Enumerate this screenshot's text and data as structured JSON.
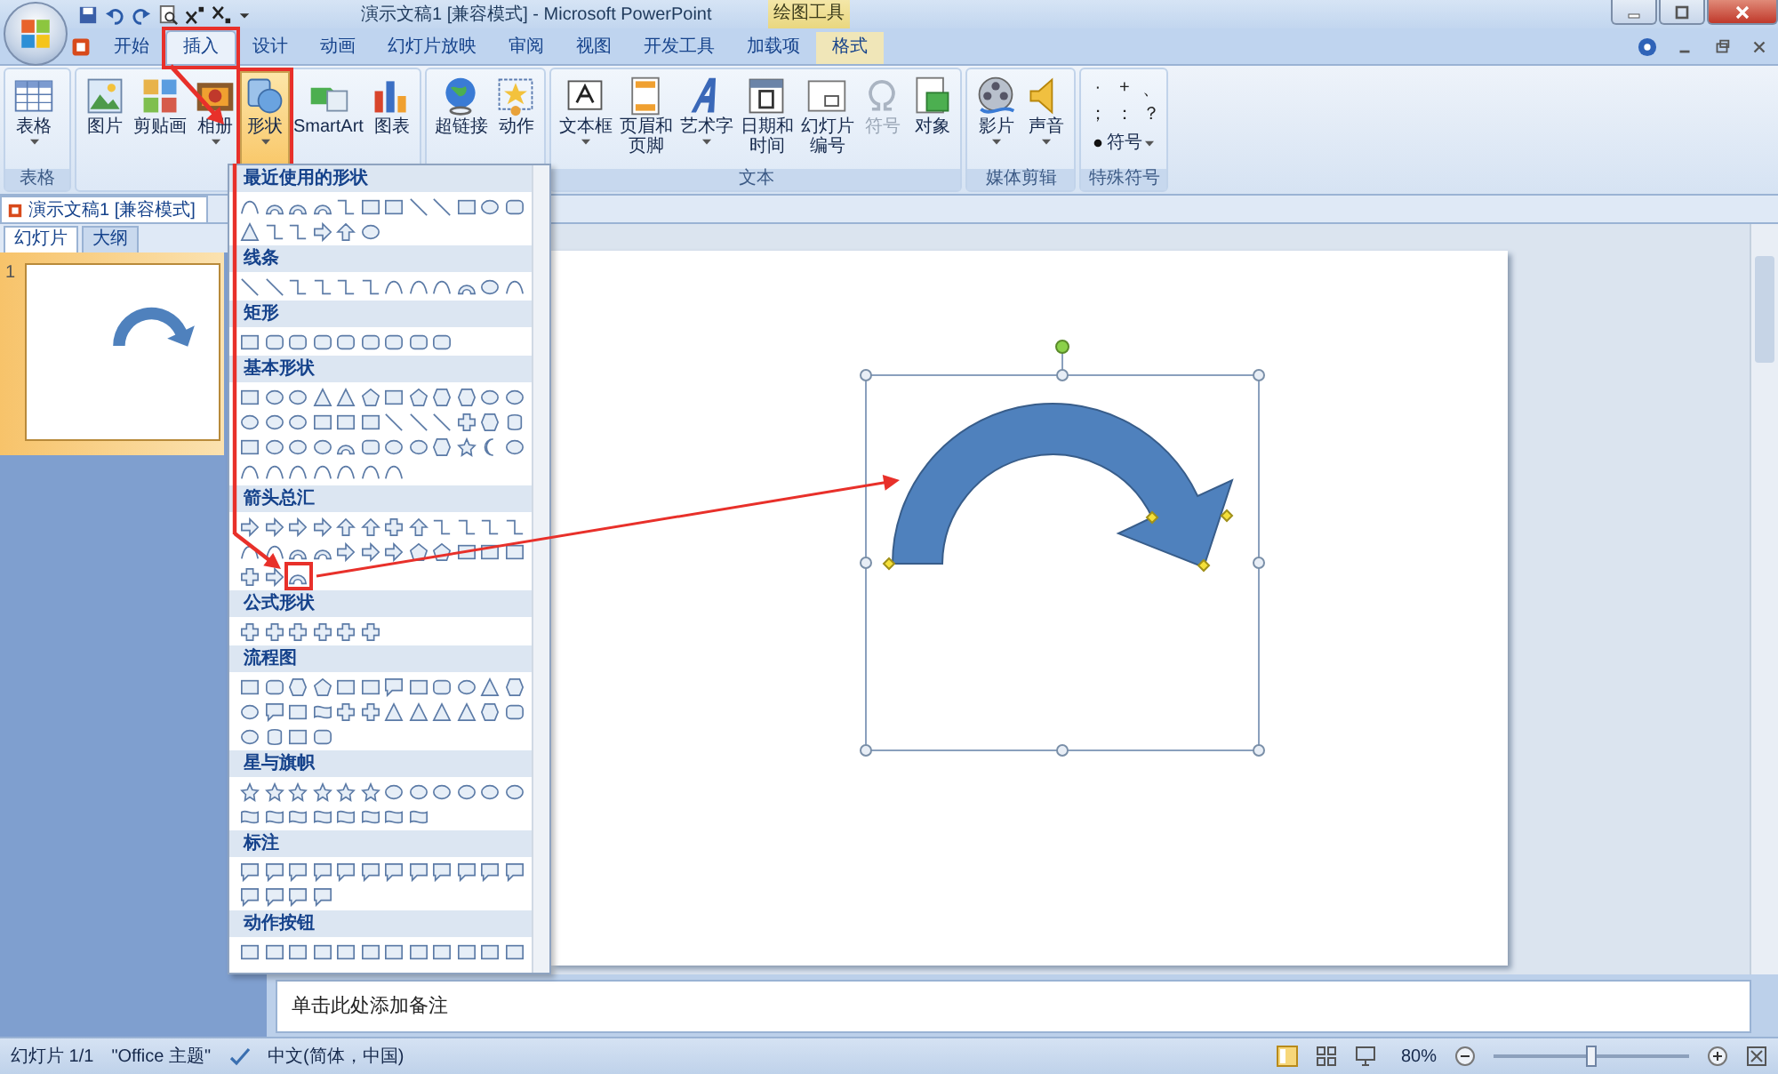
{
  "title_bar": {
    "title": "演示文稿1 [兼容模式] - Microsoft PowerPoint",
    "context_label": "绘图工具"
  },
  "tabs": [
    {
      "label": "开始",
      "selected": false,
      "annotated": false,
      "contextual": false
    },
    {
      "label": "插入",
      "selected": true,
      "annotated": true,
      "contextual": false
    },
    {
      "label": "设计",
      "selected": false,
      "annotated": false,
      "contextual": false
    },
    {
      "label": "动画",
      "selected": false,
      "annotated": false,
      "contextual": false
    },
    {
      "label": "幻灯片放映",
      "selected": false,
      "annotated": false,
      "contextual": false
    },
    {
      "label": "审阅",
      "selected": false,
      "annotated": false,
      "contextual": false
    },
    {
      "label": "视图",
      "selected": false,
      "annotated": false,
      "contextual": false
    },
    {
      "label": "开发工具",
      "selected": false,
      "annotated": false,
      "contextual": false
    },
    {
      "label": "加载项",
      "selected": false,
      "annotated": false,
      "contextual": false
    },
    {
      "label": "格式",
      "selected": false,
      "annotated": false,
      "contextual": true
    }
  ],
  "ribbon_groups": [
    {
      "kind": "buttons",
      "label": "表格",
      "buttons": [
        {
          "kind": "table",
          "lines": [
            "表格"
          ],
          "dropdown": true,
          "pressed": false,
          "disabled": false,
          "annotated": false
        }
      ]
    },
    {
      "kind": "buttons",
      "buttons": [
        {
          "kind": "picture",
          "lines": [
            "图片"
          ],
          "dropdown": false,
          "pressed": false,
          "disabled": false,
          "annotated": false
        },
        {
          "kind": "clipart",
          "lines": [
            "剪贴画"
          ],
          "dropdown": false,
          "pressed": false,
          "disabled": false,
          "annotated": false
        },
        {
          "kind": "album",
          "lines": [
            "相册"
          ],
          "dropdown": true,
          "pressed": false,
          "disabled": false,
          "annotated": false
        },
        {
          "kind": "shapes",
          "lines": [
            "形状"
          ],
          "dropdown": true,
          "pressed": true,
          "disabled": false,
          "annotated": true
        },
        {
          "kind": "smartart",
          "lines": [
            "SmartArt"
          ],
          "dropdown": false,
          "pressed": false,
          "disabled": false,
          "annotated": false
        },
        {
          "kind": "chart",
          "lines": [
            "图表"
          ],
          "dropdown": false,
          "pressed": false,
          "disabled": false,
          "annotated": false
        }
      ]
    },
    {
      "kind": "buttons",
      "buttons": [
        {
          "kind": "hyperlink",
          "lines": [
            "超链接"
          ],
          "dropdown": false,
          "pressed": false,
          "disabled": false,
          "annotated": false
        },
        {
          "kind": "action",
          "lines": [
            "动作"
          ],
          "dropdown": false,
          "pressed": false,
          "disabled": false,
          "annotated": false
        }
      ]
    },
    {
      "kind": "buttons",
      "label": "文本",
      "buttons": [
        {
          "kind": "textbox",
          "lines": [
            "文本框"
          ],
          "dropdown": true,
          "pressed": false,
          "disabled": false,
          "annotated": false
        },
        {
          "kind": "headerfooter",
          "lines": [
            "页眉和",
            "页脚"
          ],
          "dropdown": false,
          "pressed": false,
          "disabled": false,
          "annotated": false
        },
        {
          "kind": "wordart",
          "lines": [
            "艺术字"
          ],
          "dropdown": true,
          "pressed": false,
          "disabled": false,
          "annotated": false
        },
        {
          "kind": "datetime",
          "lines": [
            "日期和",
            "时间"
          ],
          "dropdown": false,
          "pressed": false,
          "disabled": false,
          "annotated": false
        },
        {
          "kind": "slidenumber",
          "lines": [
            "幻灯片",
            "编号"
          ],
          "dropdown": false,
          "pressed": false,
          "disabled": false,
          "annotated": false
        },
        {
          "kind": "symbol",
          "lines": [
            "符号"
          ],
          "dropdown": false,
          "pressed": false,
          "disabled": true,
          "annotated": false
        },
        {
          "kind": "object",
          "lines": [
            "对象"
          ],
          "dropdown": false,
          "pressed": false,
          "disabled": false,
          "annotated": false
        }
      ]
    },
    {
      "kind": "buttons",
      "label": "媒体剪辑",
      "buttons": [
        {
          "kind": "movie",
          "lines": [
            "影片"
          ],
          "dropdown": true,
          "pressed": false,
          "disabled": false,
          "annotated": false
        },
        {
          "kind": "sound",
          "lines": [
            "声音"
          ],
          "dropdown": true,
          "pressed": false,
          "disabled": false,
          "annotated": false
        }
      ]
    },
    {
      "kind": "symbols",
      "label": "特殊符号",
      "symbols": [
        "·",
        "+",
        "、",
        "；",
        "：",
        "？"
      ],
      "menu_label": "符号"
    }
  ],
  "doc_tab": {
    "title": "演示文稿1 [兼容模式]"
  },
  "panel_tabs": [
    {
      "label": "幻灯片",
      "selected": true
    },
    {
      "label": "大纲",
      "selected": false
    }
  ],
  "slide_thumbnail": {
    "number": "1",
    "selected": true
  },
  "notes": {
    "placeholder": "单击此处添加备注"
  },
  "status_bar": {
    "slide": "幻灯片 1/1",
    "theme": "\"Office 主题\"",
    "language": "中文(简体，中国)",
    "zoom": "80%",
    "zoom_slider": {
      "level": 0.5
    }
  },
  "shapes_gallery": {
    "sections": [
      {
        "title": "最近使用的形状",
        "annotated": false
      },
      {
        "title": "线条",
        "annotated": false
      },
      {
        "title": "矩形",
        "annotated": false
      },
      {
        "title": "基本形状",
        "annotated": false
      },
      {
        "title": "箭头总汇",
        "annotated": true
      },
      {
        "title": "公式形状",
        "annotated": false
      },
      {
        "title": "流程图",
        "annotated": false
      },
      {
        "title": "星与旗帜",
        "annotated": false
      },
      {
        "title": "标注",
        "annotated": false
      },
      {
        "title": "动作按钮",
        "annotated": false
      }
    ]
  }
}
